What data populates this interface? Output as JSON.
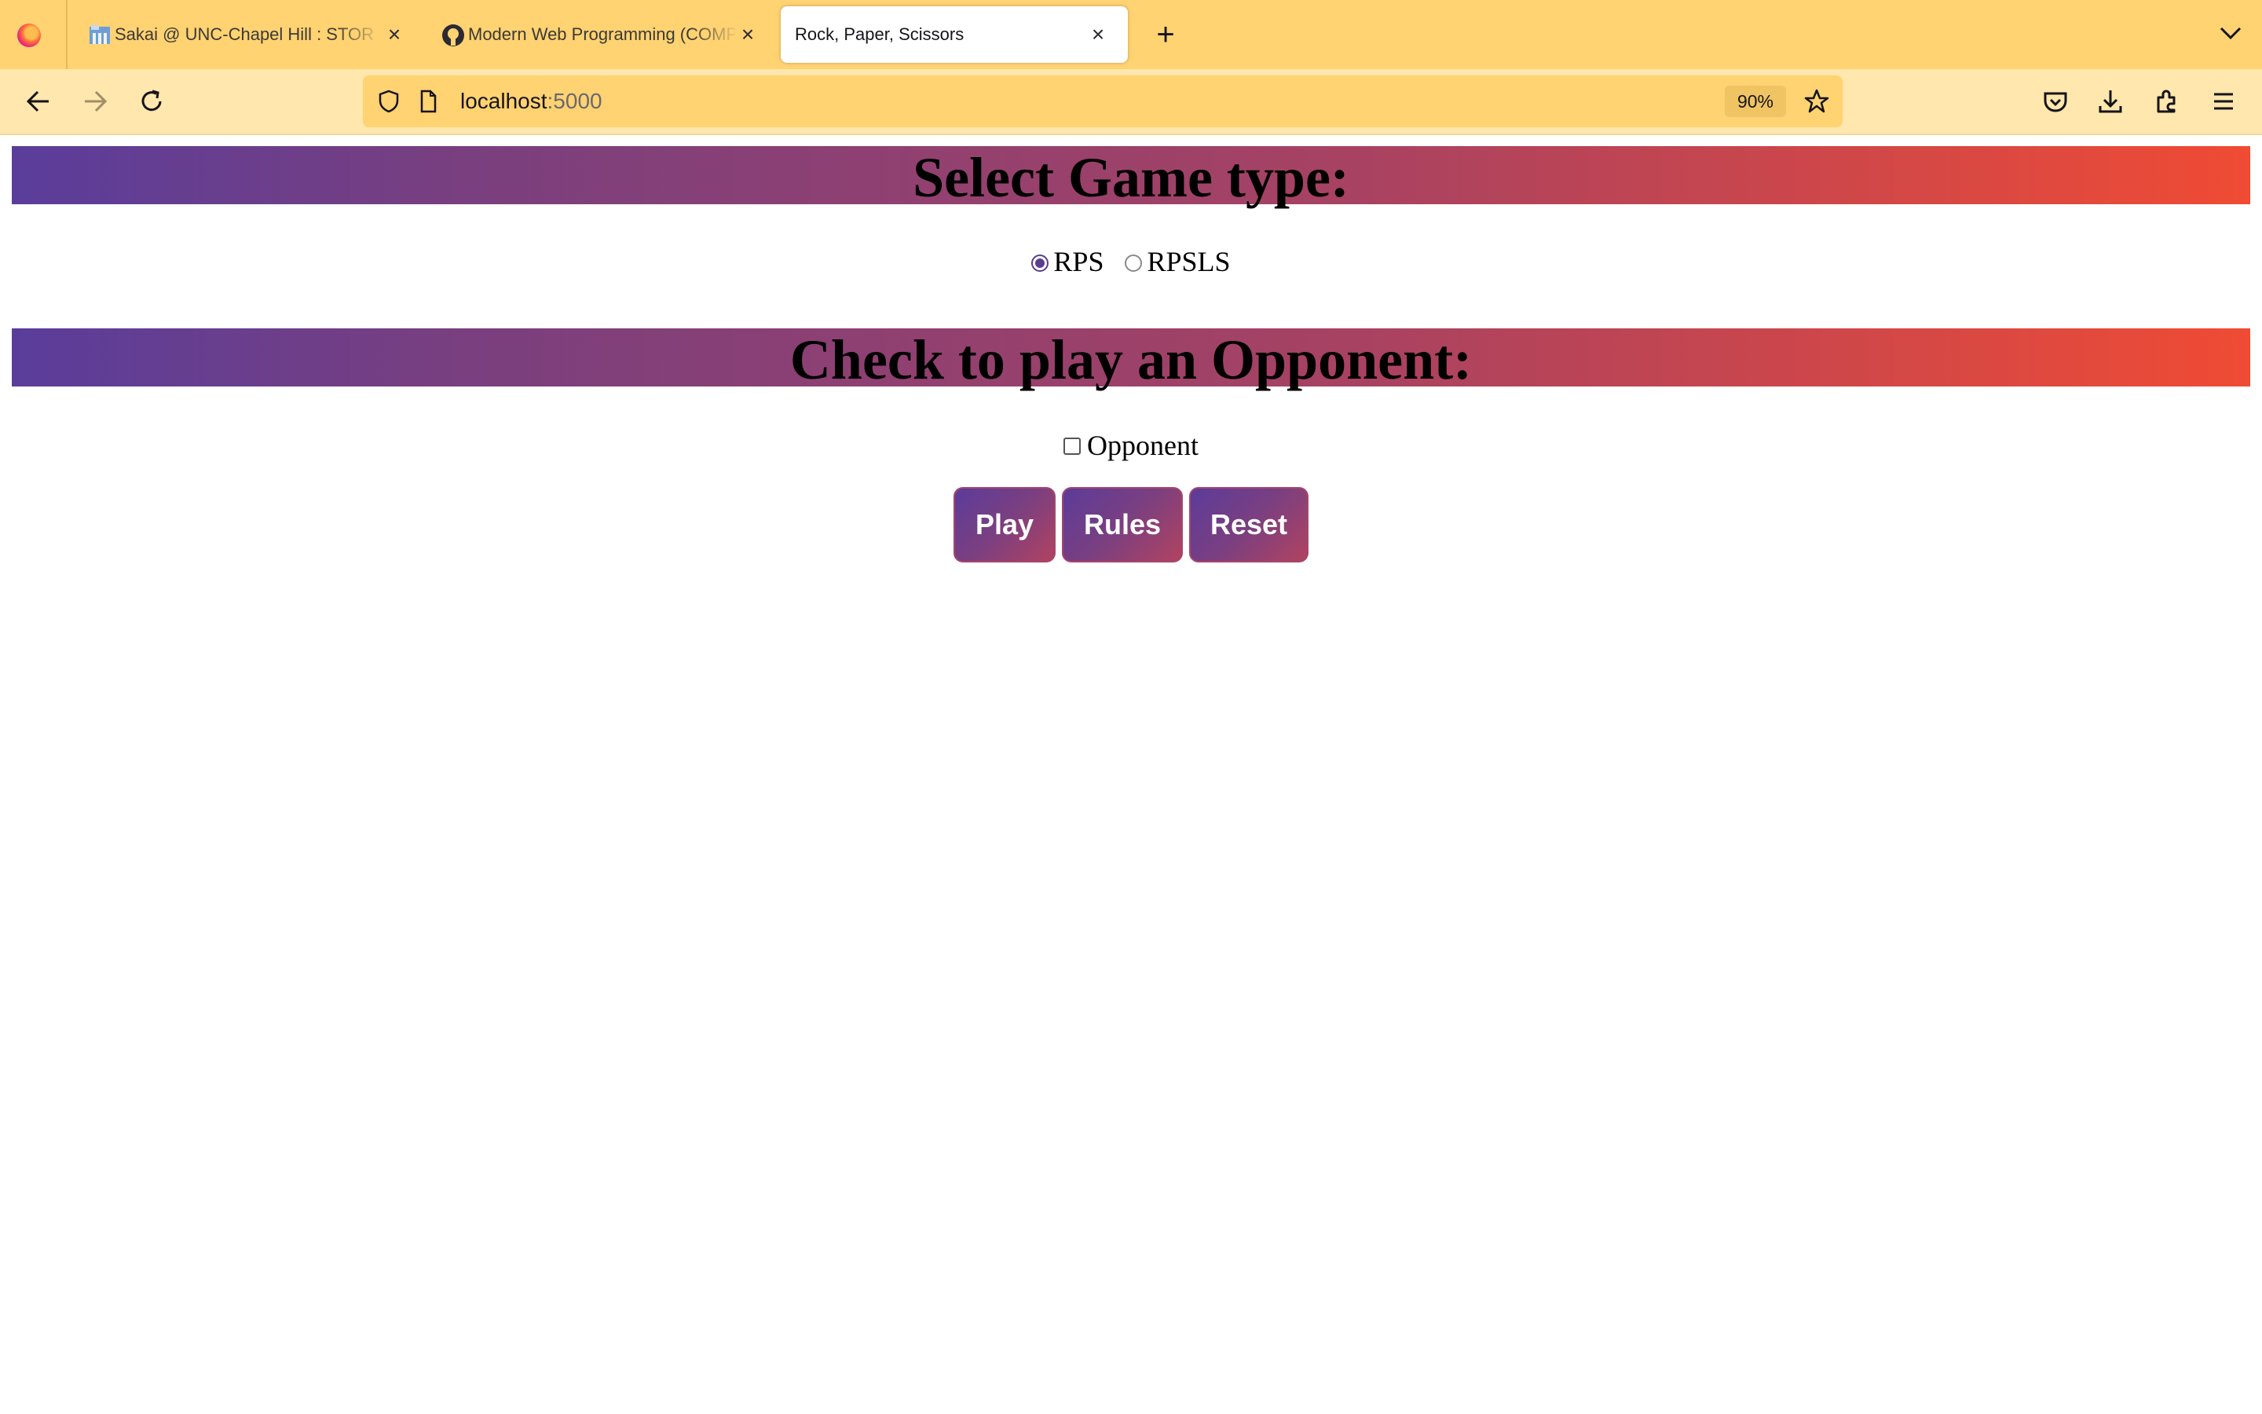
{
  "browser": {
    "tabs": [
      {
        "title": "Sakai @ UNC-Chapel Hill : STOR",
        "icon": "sakai-icon",
        "active": false
      },
      {
        "title": "Modern Web Programming (COMP",
        "icon": "github-icon",
        "active": false
      },
      {
        "title": "Rock, Paper, Scissors",
        "icon": "",
        "active": true
      }
    ],
    "url_host": "localhost",
    "url_port": ":5000",
    "zoom": "90%"
  },
  "page": {
    "game_type_heading": "Select Game type:",
    "game_types": [
      {
        "label": "RPS",
        "checked": true
      },
      {
        "label": "RPSLS",
        "checked": false
      }
    ],
    "opponent_heading": "Check to play an Opponent:",
    "opponent_label": "Opponent",
    "opponent_checked": false,
    "buttons": {
      "play": "Play",
      "rules": "Rules",
      "reset": "Reset"
    }
  },
  "colors": {
    "tabbar": "#ffd272",
    "navbar": "#ffe7ad",
    "banner_start": "#5a3d9b",
    "banner_end": "#f04b34"
  }
}
